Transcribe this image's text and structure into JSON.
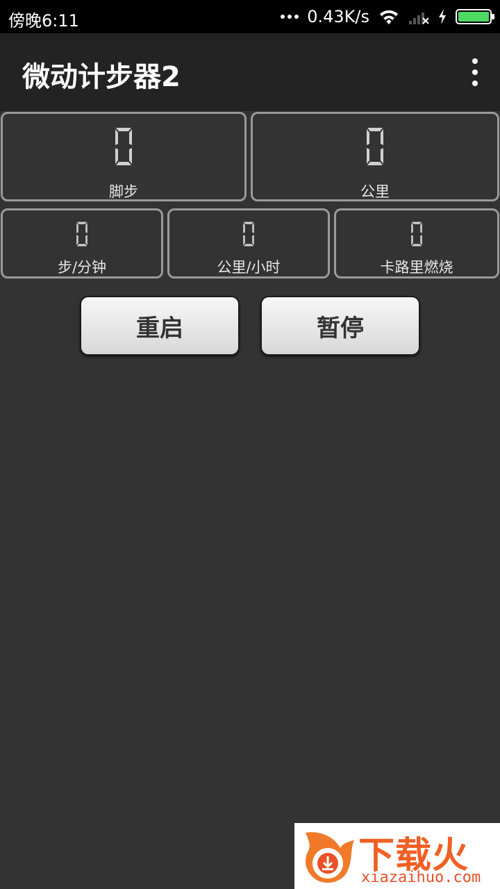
{
  "status_bar": {
    "time": "傍晚6:11",
    "net_speed": "0.43K/s",
    "battery_level": 1.0,
    "battery_color": "#4cd964"
  },
  "app_bar": {
    "title": "微动计步器2",
    "menu_icon": "more-vert-icon"
  },
  "stats": {
    "steps": {
      "value": "0",
      "label": "脚步"
    },
    "distance": {
      "value": "0",
      "label": "公里"
    },
    "pace": {
      "value": "0",
      "label": "步/分钟"
    },
    "speed": {
      "value": "0",
      "label": "公里/小时"
    },
    "calories": {
      "value": "0",
      "label": "卡路里燃烧"
    }
  },
  "buttons": {
    "reset": "重启",
    "pause": "暂停"
  },
  "watermark": {
    "brand": "下载火",
    "url": "xiazaihuo.com"
  },
  "colors": {
    "background": "#333333",
    "app_bar": "#232323",
    "card_border": "#9a9a9a",
    "digit": "#d0d0d0"
  }
}
